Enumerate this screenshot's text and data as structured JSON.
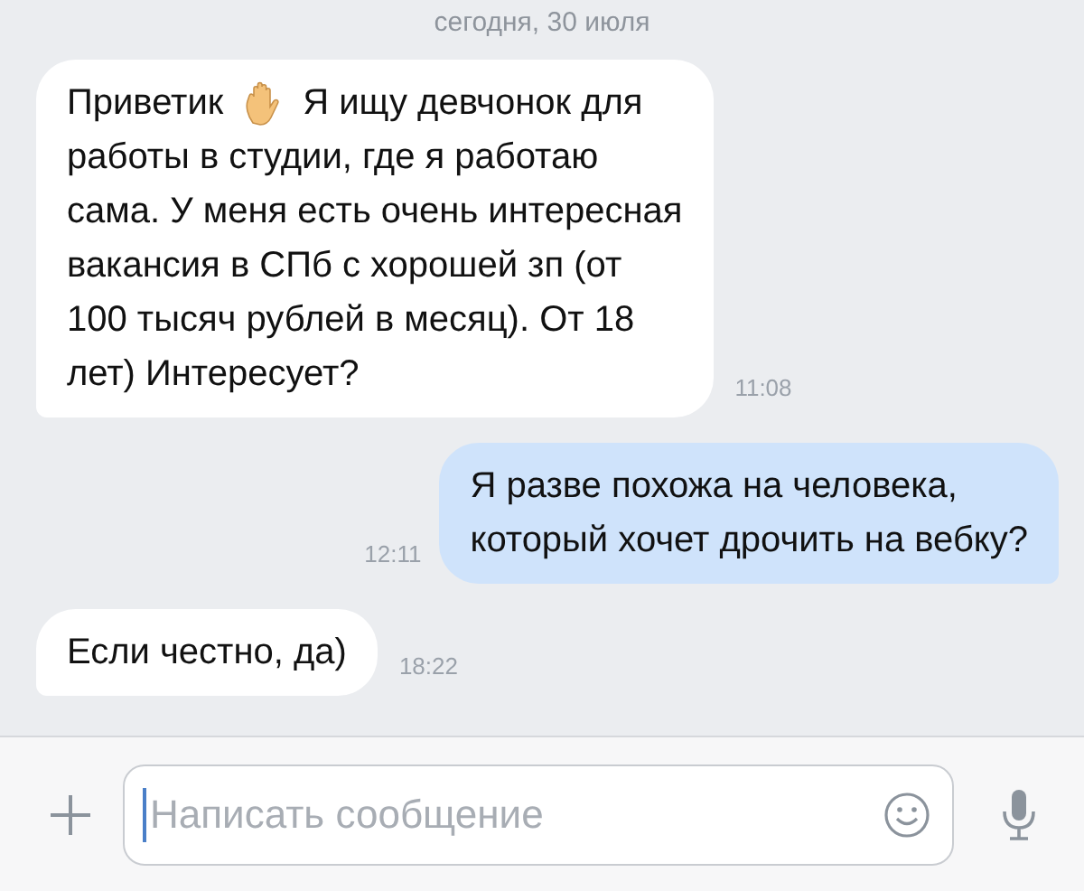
{
  "date_label": "сегодня, 30 июля",
  "messages": [
    {
      "kind": "incoming",
      "time": "11:08",
      "lines": [
        {
          "parts": [
            {
              "kind": "text",
              "text": "Приветик"
            },
            {
              "kind": "emoji"
            },
            {
              "kind": "text",
              "text": "Я ищу девчонок для"
            }
          ]
        },
        {
          "parts": [
            {
              "kind": "text",
              "text": "работы в студии, где я работаю"
            }
          ]
        },
        {
          "parts": [
            {
              "kind": "text",
              "text": "сама. У меня есть очень интересная"
            }
          ]
        },
        {
          "parts": [
            {
              "kind": "text",
              "text": "вакансия в СПб с хорошей зп (от"
            }
          ]
        },
        {
          "parts": [
            {
              "kind": "text",
              "text": "100 тысяч рублей в месяц). От 18"
            }
          ]
        },
        {
          "parts": [
            {
              "kind": "text",
              "text": "лет) Интересует?"
            }
          ]
        }
      ]
    },
    {
      "kind": "outgoing",
      "time": "12:11",
      "lines": [
        {
          "parts": [
            {
              "kind": "text",
              "text": "Я разве похожа на человека,"
            }
          ]
        },
        {
          "parts": [
            {
              "kind": "text",
              "text": "который хочет дрочить на вебку?"
            }
          ]
        }
      ]
    },
    {
      "kind": "incoming",
      "time": "18:22",
      "lines": [
        {
          "parts": [
            {
              "kind": "text",
              "text": "Если честно, да)"
            }
          ]
        }
      ]
    }
  ],
  "composer": {
    "placeholder": "Написать сообщение"
  }
}
